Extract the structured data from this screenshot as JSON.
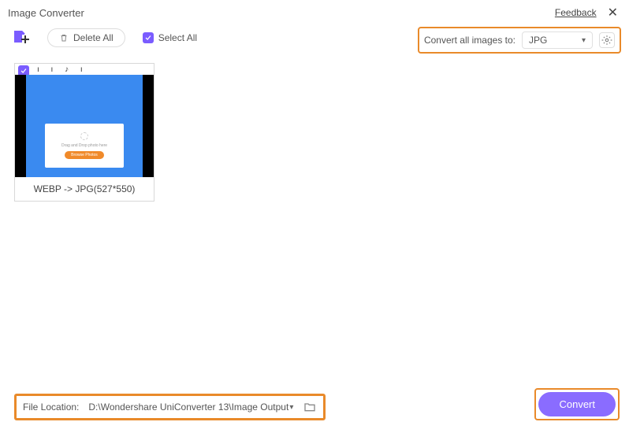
{
  "header": {
    "title": "Image Converter",
    "feedback": "Feedback"
  },
  "toolbar": {
    "delete_all": "Delete All",
    "select_all": "Select All"
  },
  "convert_bar": {
    "label": "Convert all images to:",
    "format": "JPG"
  },
  "thumbnail": {
    "panel_text": "Drag and Drop photo here",
    "panel_button": "Browse Photos",
    "caption": "WEBP -> JPG(527*550)"
  },
  "footer": {
    "location_label": "File Location:",
    "location_path": "D:\\Wondershare UniConverter 13\\Image Output",
    "convert": "Convert"
  }
}
